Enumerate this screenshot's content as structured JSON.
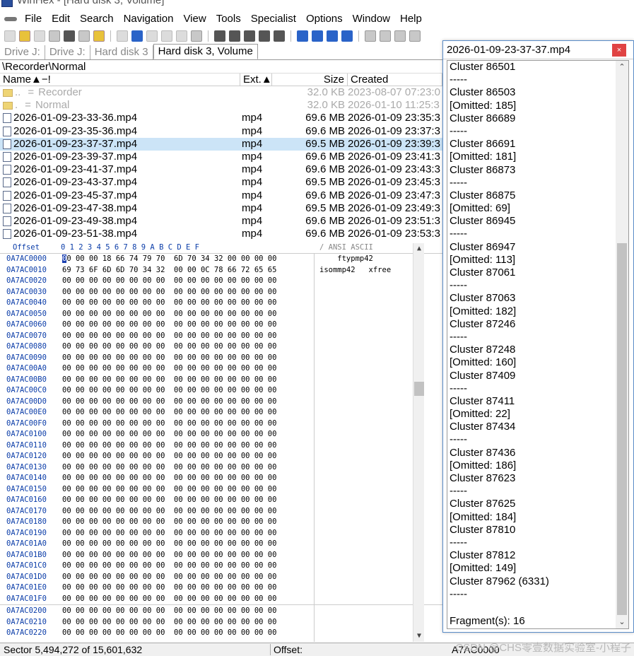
{
  "window": {
    "title": "WinHex - [Hard disk 3, Volume]"
  },
  "menu": [
    "File",
    "Edit",
    "Search",
    "Navigation",
    "View",
    "Tools",
    "Specialist",
    "Options",
    "Window",
    "Help"
  ],
  "tabs": [
    "Drive J:",
    "Drive J:",
    "Hard disk 3",
    "Hard disk 3, Volume"
  ],
  "path": "\\Recorder\\Normal",
  "file_list": {
    "headers": {
      "name": "Name▲−!",
      "ext": "Ext.▲",
      "size": "Size",
      "created": "Created"
    },
    "dirs": [
      {
        "name": "..",
        "eq": "=",
        "label": "Recorder",
        "size": "32.0 KB",
        "created": "2023-08-07  07:23:0"
      },
      {
        "name": ".",
        "eq": "=",
        "label": "Normal",
        "size": "32.0 KB",
        "created": "2026-01-10  11:25:3"
      }
    ],
    "files": [
      {
        "name": "2026-01-09-23-33-36.mp4",
        "ext": "mp4",
        "size": "69.6 MB",
        "created": "2026-01-09  23:35:3"
      },
      {
        "name": "2026-01-09-23-35-36.mp4",
        "ext": "mp4",
        "size": "69.6 MB",
        "created": "2026-01-09  23:37:3"
      },
      {
        "name": "2026-01-09-23-37-37.mp4",
        "ext": "mp4",
        "size": "69.5 MB",
        "created": "2026-01-09  23:39:3"
      },
      {
        "name": "2026-01-09-23-39-37.mp4",
        "ext": "mp4",
        "size": "69.6 MB",
        "created": "2026-01-09  23:41:3"
      },
      {
        "name": "2026-01-09-23-41-37.mp4",
        "ext": "mp4",
        "size": "69.6 MB",
        "created": "2026-01-09  23:43:3"
      },
      {
        "name": "2026-01-09-23-43-37.mp4",
        "ext": "mp4",
        "size": "69.5 MB",
        "created": "2026-01-09  23:45:3"
      },
      {
        "name": "2026-01-09-23-45-37.mp4",
        "ext": "mp4",
        "size": "69.6 MB",
        "created": "2026-01-09  23:47:3"
      },
      {
        "name": "2026-01-09-23-47-38.mp4",
        "ext": "mp4",
        "size": "69.5 MB",
        "created": "2026-01-09  23:49:3"
      },
      {
        "name": "2026-01-09-23-49-38.mp4",
        "ext": "mp4",
        "size": "69.6 MB",
        "created": "2026-01-09  23:51:3"
      },
      {
        "name": "2026-01-09-23-51-38.mp4",
        "ext": "mp4",
        "size": "69.6 MB",
        "created": "2026-01-09  23:53:3"
      }
    ],
    "selected_index": 2
  },
  "hex": {
    "header_offset": "Offset",
    "header_bytes": " 0  1  2  3  4  5  6  7   8  9  A  B  C  D  E  F",
    "header_ascii": "/  ANSI ASCII",
    "rows": [
      {
        "off": "0A7AC0000",
        "bytes": "00 00 00 18 66 74 79 70  6D 70 34 32 00 00 00 00",
        "ascii": "    ftypmp42"
      },
      {
        "off": "0A7AC0010",
        "bytes": "69 73 6F 6D 6D 70 34 32  00 00 0C 78 66 72 65 65",
        "ascii": "isommp42   xfree"
      },
      {
        "off": "0A7AC0020",
        "bytes": "00 00 00 00 00 00 00 00  00 00 00 00 00 00 00 00",
        "ascii": ""
      },
      {
        "off": "0A7AC0030",
        "bytes": "00 00 00 00 00 00 00 00  00 00 00 00 00 00 00 00",
        "ascii": ""
      },
      {
        "off": "0A7AC0040",
        "bytes": "00 00 00 00 00 00 00 00  00 00 00 00 00 00 00 00",
        "ascii": ""
      },
      {
        "off": "0A7AC0050",
        "bytes": "00 00 00 00 00 00 00 00  00 00 00 00 00 00 00 00",
        "ascii": ""
      },
      {
        "off": "0A7AC0060",
        "bytes": "00 00 00 00 00 00 00 00  00 00 00 00 00 00 00 00",
        "ascii": ""
      },
      {
        "off": "0A7AC0070",
        "bytes": "00 00 00 00 00 00 00 00  00 00 00 00 00 00 00 00",
        "ascii": ""
      },
      {
        "off": "0A7AC0080",
        "bytes": "00 00 00 00 00 00 00 00  00 00 00 00 00 00 00 00",
        "ascii": ""
      },
      {
        "off": "0A7AC0090",
        "bytes": "00 00 00 00 00 00 00 00  00 00 00 00 00 00 00 00",
        "ascii": ""
      },
      {
        "off": "0A7AC00A0",
        "bytes": "00 00 00 00 00 00 00 00  00 00 00 00 00 00 00 00",
        "ascii": ""
      },
      {
        "off": "0A7AC00B0",
        "bytes": "00 00 00 00 00 00 00 00  00 00 00 00 00 00 00 00",
        "ascii": ""
      },
      {
        "off": "0A7AC00C0",
        "bytes": "00 00 00 00 00 00 00 00  00 00 00 00 00 00 00 00",
        "ascii": ""
      },
      {
        "off": "0A7AC00D0",
        "bytes": "00 00 00 00 00 00 00 00  00 00 00 00 00 00 00 00",
        "ascii": ""
      },
      {
        "off": "0A7AC00E0",
        "bytes": "00 00 00 00 00 00 00 00  00 00 00 00 00 00 00 00",
        "ascii": ""
      },
      {
        "off": "0A7AC00F0",
        "bytes": "00 00 00 00 00 00 00 00  00 00 00 00 00 00 00 00",
        "ascii": ""
      },
      {
        "off": "0A7AC0100",
        "bytes": "00 00 00 00 00 00 00 00  00 00 00 00 00 00 00 00",
        "ascii": ""
      },
      {
        "off": "0A7AC0110",
        "bytes": "00 00 00 00 00 00 00 00  00 00 00 00 00 00 00 00",
        "ascii": ""
      },
      {
        "off": "0A7AC0120",
        "bytes": "00 00 00 00 00 00 00 00  00 00 00 00 00 00 00 00",
        "ascii": ""
      },
      {
        "off": "0A7AC0130",
        "bytes": "00 00 00 00 00 00 00 00  00 00 00 00 00 00 00 00",
        "ascii": ""
      },
      {
        "off": "0A7AC0140",
        "bytes": "00 00 00 00 00 00 00 00  00 00 00 00 00 00 00 00",
        "ascii": ""
      },
      {
        "off": "0A7AC0150",
        "bytes": "00 00 00 00 00 00 00 00  00 00 00 00 00 00 00 00",
        "ascii": ""
      },
      {
        "off": "0A7AC0160",
        "bytes": "00 00 00 00 00 00 00 00  00 00 00 00 00 00 00 00",
        "ascii": ""
      },
      {
        "off": "0A7AC0170",
        "bytes": "00 00 00 00 00 00 00 00  00 00 00 00 00 00 00 00",
        "ascii": ""
      },
      {
        "off": "0A7AC0180",
        "bytes": "00 00 00 00 00 00 00 00  00 00 00 00 00 00 00 00",
        "ascii": ""
      },
      {
        "off": "0A7AC0190",
        "bytes": "00 00 00 00 00 00 00 00  00 00 00 00 00 00 00 00",
        "ascii": ""
      },
      {
        "off": "0A7AC01A0",
        "bytes": "00 00 00 00 00 00 00 00  00 00 00 00 00 00 00 00",
        "ascii": ""
      },
      {
        "off": "0A7AC01B0",
        "bytes": "00 00 00 00 00 00 00 00  00 00 00 00 00 00 00 00",
        "ascii": ""
      },
      {
        "off": "0A7AC01C0",
        "bytes": "00 00 00 00 00 00 00 00  00 00 00 00 00 00 00 00",
        "ascii": ""
      },
      {
        "off": "0A7AC01D0",
        "bytes": "00 00 00 00 00 00 00 00  00 00 00 00 00 00 00 00",
        "ascii": ""
      },
      {
        "off": "0A7AC01E0",
        "bytes": "00 00 00 00 00 00 00 00  00 00 00 00 00 00 00 00",
        "ascii": ""
      },
      {
        "off": "0A7AC01F0",
        "bytes": "00 00 00 00 00 00 00 00  00 00 00 00 00 00 00 00",
        "ascii": ""
      },
      {
        "off": "0A7AC0200",
        "bytes": "00 00 00 00 00 00 00 00  00 00 00 00 00 00 00 00",
        "ascii": ""
      },
      {
        "off": "0A7AC0210",
        "bytes": "00 00 00 00 00 00 00 00  00 00 00 00 00 00 00 00",
        "ascii": ""
      },
      {
        "off": "0A7AC0220",
        "bytes": "00 00 00 00 00 00 00 00  00 00 00 00 00 00 00 00",
        "ascii": ""
      }
    ]
  },
  "status": {
    "sector": "Sector 5,494,272 of 15,601,632",
    "offset_label": "Offset:",
    "offset_value": "A7AC0000"
  },
  "watermark": "CSDN @CHS零壹数据实验室-小程子",
  "dialog": {
    "title": "2026-01-09-23-37-37.mp4",
    "close_icon": "×",
    "lines": [
      "Cluster 86501",
      "-----",
      "Cluster 86503",
      "[Omitted: 185]",
      "Cluster 86689",
      "-----",
      "Cluster 86691",
      "[Omitted: 181]",
      "Cluster 86873",
      "-----",
      "Cluster 86875",
      "[Omitted: 69]",
      "Cluster 86945",
      "-----",
      "Cluster 86947",
      "[Omitted: 113]",
      "Cluster 87061",
      "-----",
      "Cluster 87063",
      "[Omitted: 182]",
      "Cluster 87246",
      "-----",
      "Cluster 87248",
      "[Omitted: 160]",
      "Cluster 87409",
      "-----",
      "Cluster 87411",
      "[Omitted: 22]",
      "Cluster 87434",
      "-----",
      "Cluster 87436",
      "[Omitted: 186]",
      "Cluster 87623",
      "-----",
      "Cluster 87625",
      "[Omitted: 184]",
      "Cluster 87810",
      "-----",
      "Cluster 87812",
      "[Omitted: 149]",
      "Cluster 87962 (6331)",
      "-----"
    ],
    "fragments": "Fragment(s):  16"
  }
}
